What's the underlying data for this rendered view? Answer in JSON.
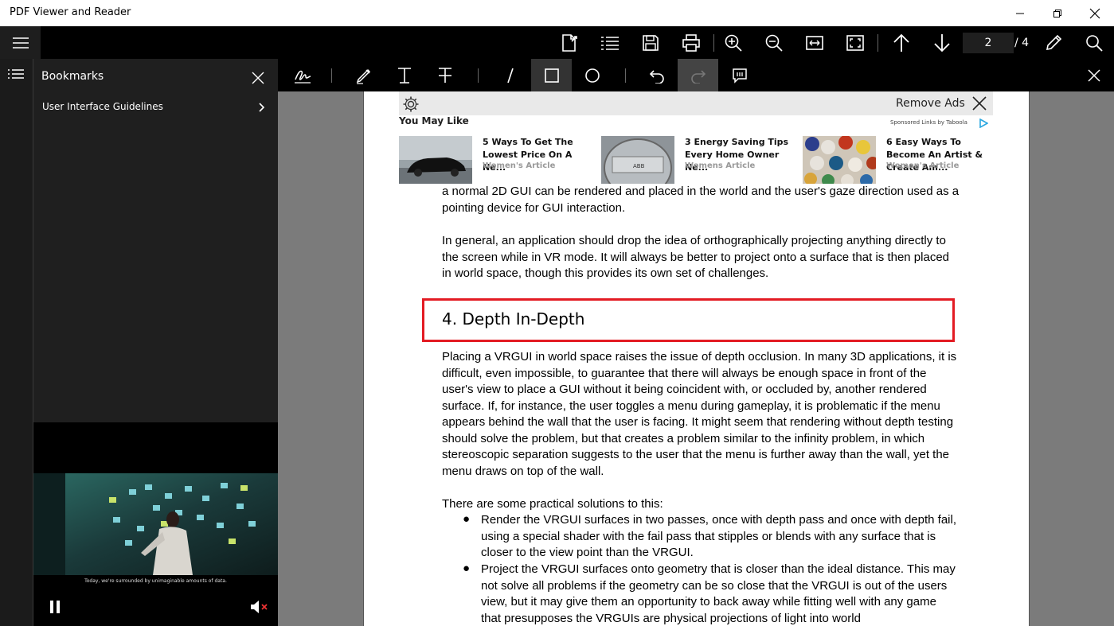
{
  "app": {
    "title": "PDF Viewer and Reader"
  },
  "toolbar": {
    "page_current": "2",
    "page_total": "/ 4"
  },
  "bookmarks": {
    "title": "Bookmarks",
    "items": [
      {
        "label": "User Interface Guidelines"
      }
    ]
  },
  "video": {
    "caption": "Today, we're surrounded by unimaginable amounts of data."
  },
  "ad": {
    "remove_ads": "Remove Ads",
    "you_may_like": "You May Like",
    "sponsored": "Sponsored Links by Taboola",
    "cards": [
      {
        "headline": "5 Ways To Get The Lowest Price On A Ne...",
        "source": "Women's Article"
      },
      {
        "headline": "3 Energy Saving Tips Every Home Owner Ne...",
        "source": "Womens Article"
      },
      {
        "headline": "6 Easy Ways To Become An Artist & Create Am...",
        "source": "Women's Article"
      }
    ]
  },
  "document": {
    "para1": "a normal 2D GUI can be rendered and placed in the world and the user's gaze direction used as a pointing device for GUI interaction.",
    "para2": "In general, an application should drop the idea of orthographically projecting anything directly to the screen while in VR mode. It will always be better to project onto a surface that is then placed in world space, though this provides its own set of challenges.",
    "heading": "4. Depth In-Depth",
    "para3": "Placing a VRGUI in world space raises the issue of depth occlusion. In many 3D applications, it is difficult, even impossible, to guarantee that there will always be enough space in front of the user's view to place a GUI without it being coincident with, or occluded by, another rendered surface. If, for instance, the user toggles a menu during gameplay, it is problematic if the menu appears behind the wall that the user is facing. It might seem that rendering without depth testing should solve the problem, but that creates a problem similar to the infinity problem, in which stereoscopic separation suggests to the user that the menu is further away than the wall, yet the menu draws on top of the wall.",
    "para4": "There are some practical solutions to this:",
    "bullet_mark": "●",
    "bullets": [
      "Render the VRGUI surfaces in two passes, once with depth pass and once with depth fail, using a special shader with the fail pass that stipples or blends with any surface that is closer to the view point than the VRGUI.",
      "Project the VRGUI surfaces onto geometry that is closer than the ideal distance. This may not solve all problems if the geometry can be so close that the VRGUI is out of the users view, but it may give them an opportunity to back away while fitting well with any game that presupposes the VRGUIs are physical projections of light into world"
    ]
  },
  "colors": {
    "highlight_box": "#e31b23",
    "toolbar_bg": "#000000",
    "viewer_bg": "#7b7b7b"
  }
}
